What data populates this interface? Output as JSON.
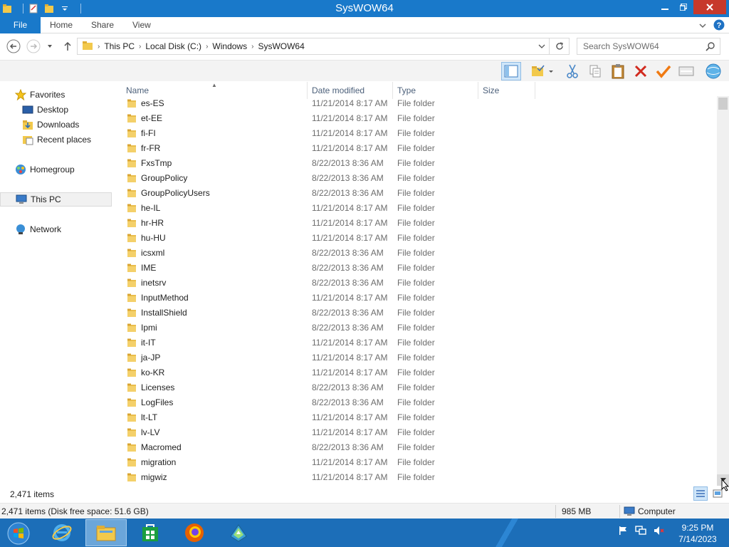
{
  "window": {
    "title": "SysWOW64"
  },
  "ribbon": {
    "tabs": [
      {
        "label": "File"
      },
      {
        "label": "Home"
      },
      {
        "label": "Share"
      },
      {
        "label": "View"
      }
    ]
  },
  "address": {
    "crumbs": [
      "This PC",
      "Local Disk (C:)",
      "Windows",
      "SysWOW64"
    ]
  },
  "search": {
    "placeholder": "Search SysWOW64"
  },
  "navpane": {
    "items": [
      {
        "label": "Favorites",
        "icon": "star-icon",
        "level": 0
      },
      {
        "label": "Desktop",
        "icon": "desktop-icon",
        "level": 1
      },
      {
        "label": "Downloads",
        "icon": "downloads-icon",
        "level": 1
      },
      {
        "label": "Recent places",
        "icon": "recent-places-icon",
        "level": 1
      },
      {
        "label": "Homegroup",
        "icon": "homegroup-icon",
        "level": 0
      },
      {
        "label": "This PC",
        "icon": "computer-icon",
        "level": 0,
        "selected": true
      },
      {
        "label": "Network",
        "icon": "network-icon",
        "level": 0
      }
    ]
  },
  "columns": {
    "name": "Name",
    "date": "Date modified",
    "type": "Type",
    "size": "Size"
  },
  "files": [
    {
      "name": "es-ES",
      "date": "11/21/2014 8:17 AM",
      "type": "File folder"
    },
    {
      "name": "et-EE",
      "date": "11/21/2014 8:17 AM",
      "type": "File folder"
    },
    {
      "name": "fi-FI",
      "date": "11/21/2014 8:17 AM",
      "type": "File folder"
    },
    {
      "name": "fr-FR",
      "date": "11/21/2014 8:17 AM",
      "type": "File folder"
    },
    {
      "name": "FxsTmp",
      "date": "8/22/2013 8:36 AM",
      "type": "File folder"
    },
    {
      "name": "GroupPolicy",
      "date": "8/22/2013 8:36 AM",
      "type": "File folder"
    },
    {
      "name": "GroupPolicyUsers",
      "date": "8/22/2013 8:36 AM",
      "type": "File folder"
    },
    {
      "name": "he-IL",
      "date": "11/21/2014 8:17 AM",
      "type": "File folder"
    },
    {
      "name": "hr-HR",
      "date": "11/21/2014 8:17 AM",
      "type": "File folder"
    },
    {
      "name": "hu-HU",
      "date": "11/21/2014 8:17 AM",
      "type": "File folder"
    },
    {
      "name": "icsxml",
      "date": "8/22/2013 8:36 AM",
      "type": "File folder"
    },
    {
      "name": "IME",
      "date": "8/22/2013 8:36 AM",
      "type": "File folder"
    },
    {
      "name": "inetsrv",
      "date": "8/22/2013 8:36 AM",
      "type": "File folder"
    },
    {
      "name": "InputMethod",
      "date": "11/21/2014 8:17 AM",
      "type": "File folder"
    },
    {
      "name": "InstallShield",
      "date": "8/22/2013 8:36 AM",
      "type": "File folder"
    },
    {
      "name": "Ipmi",
      "date": "8/22/2013 8:36 AM",
      "type": "File folder"
    },
    {
      "name": "it-IT",
      "date": "11/21/2014 8:17 AM",
      "type": "File folder"
    },
    {
      "name": "ja-JP",
      "date": "11/21/2014 8:17 AM",
      "type": "File folder"
    },
    {
      "name": "ko-KR",
      "date": "11/21/2014 8:17 AM",
      "type": "File folder"
    },
    {
      "name": "Licenses",
      "date": "8/22/2013 8:36 AM",
      "type": "File folder"
    },
    {
      "name": "LogFiles",
      "date": "8/22/2013 8:36 AM",
      "type": "File folder"
    },
    {
      "name": "lt-LT",
      "date": "11/21/2014 8:17 AM",
      "type": "File folder"
    },
    {
      "name": "lv-LV",
      "date": "11/21/2014 8:17 AM",
      "type": "File folder"
    },
    {
      "name": "Macromed",
      "date": "8/22/2013 8:36 AM",
      "type": "File folder"
    },
    {
      "name": "migration",
      "date": "11/21/2014 8:17 AM",
      "type": "File folder"
    },
    {
      "name": "migwiz",
      "date": "11/21/2014 8:17 AM",
      "type": "File folder"
    }
  ],
  "status": {
    "items_count": "2,471 items",
    "details": "2,471 items (Disk free space: 51.6 GB)",
    "size": "985 MB",
    "location": "Computer"
  },
  "taskbar": {
    "apps": [
      "internet-explorer",
      "file-explorer",
      "store",
      "firefox",
      "app-cube"
    ],
    "time": "9:25 PM",
    "date": "7/14/2023"
  },
  "colors": {
    "titlebar": "#1979ca",
    "taskbar": "#1c6eb8",
    "folder": "#e9bd4c"
  }
}
